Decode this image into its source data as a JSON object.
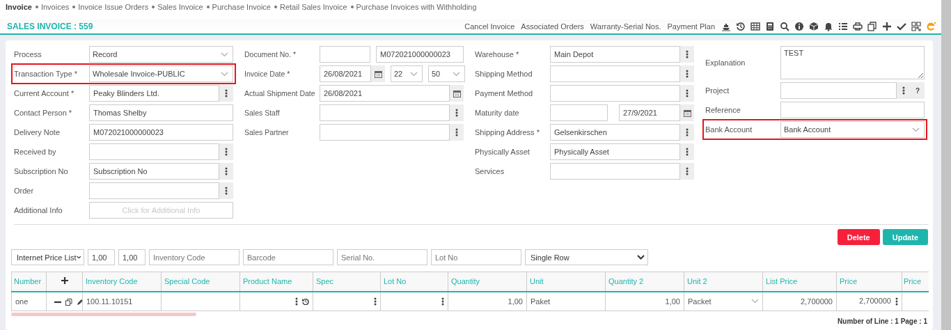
{
  "breadcrumb": [
    {
      "label": "Invoice",
      "selected": true
    },
    {
      "label": "Invoices",
      "selected": false
    },
    {
      "label": "Invoice Issue Orders",
      "selected": false
    },
    {
      "label": "Sales Invoice",
      "selected": false
    },
    {
      "label": "Purchase Invoice",
      "selected": false
    },
    {
      "label": "Retail Sales Invoice",
      "selected": false
    },
    {
      "label": "Purchase Invoices with Withholding",
      "selected": false
    }
  ],
  "header": {
    "title": "SALES INVOICE : 559",
    "actions": [
      "Cancel Invoice",
      "Associated Orders",
      "Warranty-Serial Nos.",
      "Payment Plan"
    ]
  },
  "form": {
    "columns": [
      {
        "fields": [
          {
            "label": "Process",
            "kind": "select",
            "value": "Record",
            "highlighted": false
          },
          {
            "label": "Transaction Type *",
            "kind": "select",
            "value": "Wholesale Invoice-PUBLIC",
            "highlighted": true
          },
          {
            "label": "Current Account *",
            "kind": "lookup",
            "value": "Peaky Blinders Ltd.",
            "highlighted": false
          },
          {
            "label": "Contact Person *",
            "kind": "text",
            "value": "Thomas Shelby",
            "highlighted": false
          },
          {
            "label": "Delivery Note",
            "kind": "text",
            "value": "M072021000000023",
            "highlighted": false
          },
          {
            "label": "Received by",
            "kind": "lookup",
            "highlighted": false
          },
          {
            "label": "Subscription No",
            "kind": "lookup",
            "value": "Subscription No",
            "highlighted": false
          },
          {
            "label": "Order",
            "kind": "lookup",
            "highlighted": false
          },
          {
            "label": "Additional Info",
            "kind": "button",
            "value": "Click for Additional Info",
            "highlighted": false
          }
        ]
      },
      {
        "fields": [
          {
            "label": "Document No. *",
            "kind": "pair",
            "second": "M072021000000023",
            "highlighted": false
          },
          {
            "label": "Invoice Date *",
            "kind": "datetime",
            "value": "26/08/2021",
            "hour": "22",
            "minute": "50",
            "highlighted": false
          },
          {
            "label": "Actual Shipment Date",
            "kind": "date",
            "value": "26/08/2021",
            "highlighted": false
          },
          {
            "label": "Sales Staff",
            "kind": "lookup",
            "highlighted": false
          },
          {
            "label": "Sales Partner",
            "kind": "lookup",
            "highlighted": false
          }
        ]
      },
      {
        "fields": [
          {
            "label": "Warehouse *",
            "kind": "lookup",
            "value": "Main Depot",
            "highlighted": false
          },
          {
            "label": "Shipping Method",
            "kind": "lookup",
            "highlighted": false
          },
          {
            "label": "Payment Method",
            "kind": "lookup",
            "highlighted": false
          },
          {
            "label": "Maturity date",
            "kind": "pair_date",
            "second": "27/9/2021",
            "highlighted": false
          },
          {
            "label": "Shipping Address *",
            "kind": "lookup",
            "value": "Gelsenkirschen",
            "highlighted": false
          },
          {
            "label": "Physically Asset",
            "kind": "lookup",
            "value": "Physically Asset",
            "highlighted": false
          },
          {
            "label": "Services",
            "kind": "lookup",
            "highlighted": false
          }
        ]
      },
      {
        "fields": [
          {
            "label": "Explanation",
            "kind": "textarea",
            "value": "TEST",
            "highlighted": false
          },
          {
            "label": "Project",
            "kind": "lookup_help",
            "help": "?",
            "highlighted": false
          },
          {
            "label": "Reference",
            "kind": "text",
            "highlighted": false
          },
          {
            "label": "Bank Account",
            "kind": "select",
            "value": "Bank Account",
            "highlighted": true
          }
        ]
      }
    ]
  },
  "buttons": [
    {
      "label": "Delete",
      "kind": "danger"
    },
    {
      "label": "Update",
      "kind": "primary"
    }
  ],
  "filters": [
    {
      "kind": "select",
      "value": "Internet Price List"
    },
    {
      "kind": "input",
      "value": "1,00"
    },
    {
      "kind": "input",
      "value": "1,00"
    },
    {
      "kind": "input",
      "placeholder": "Inventory Code"
    },
    {
      "kind": "input",
      "placeholder": "Barcode"
    },
    {
      "kind": "input",
      "placeholder": "Serial No."
    },
    {
      "kind": "input",
      "placeholder": "Lot No"
    },
    {
      "kind": "select",
      "value": "Single Row"
    }
  ],
  "table": {
    "columns": [
      {
        "label": "Number",
        "kind": "text"
      },
      {
        "kind": "add"
      },
      {
        "label": "Inventory Code",
        "kind": "text"
      },
      {
        "label": "Special Code",
        "kind": "text"
      },
      {
        "label": "Product Name",
        "kind": "text"
      },
      {
        "label": "Spec",
        "kind": "text"
      },
      {
        "label": "Lot No",
        "kind": "text"
      },
      {
        "label": "Quantity",
        "kind": "text"
      },
      {
        "label": "Unit",
        "kind": "text"
      },
      {
        "label": "Quantity 2",
        "kind": "text"
      },
      {
        "label": "Unit 2",
        "kind": "text"
      },
      {
        "label": "List Price",
        "kind": "text"
      },
      {
        "label": "Price",
        "kind": "text"
      },
      {
        "label": "Price",
        "kind": "text"
      }
    ],
    "rows": [
      {
        "cells": [
          {
            "kind": "text",
            "value": "one"
          },
          {
            "kind": "actions"
          },
          {
            "kind": "text",
            "value": "100.11.10151"
          },
          {
            "kind": "text"
          },
          {
            "kind": "menu_history"
          },
          {
            "kind": "menu"
          },
          {
            "kind": "menu"
          },
          {
            "kind": "number",
            "value": "1,00"
          },
          {
            "kind": "text",
            "value": "Paket"
          },
          {
            "kind": "number",
            "value": "1,00"
          },
          {
            "kind": "select",
            "value": "Packet"
          },
          {
            "kind": "number",
            "value": "2,700000"
          },
          {
            "kind": "number_menu",
            "value": "2,700000"
          },
          {
            "kind": "text"
          }
        ]
      }
    ]
  },
  "footer": "Number of Line : 1 Page : 1"
}
